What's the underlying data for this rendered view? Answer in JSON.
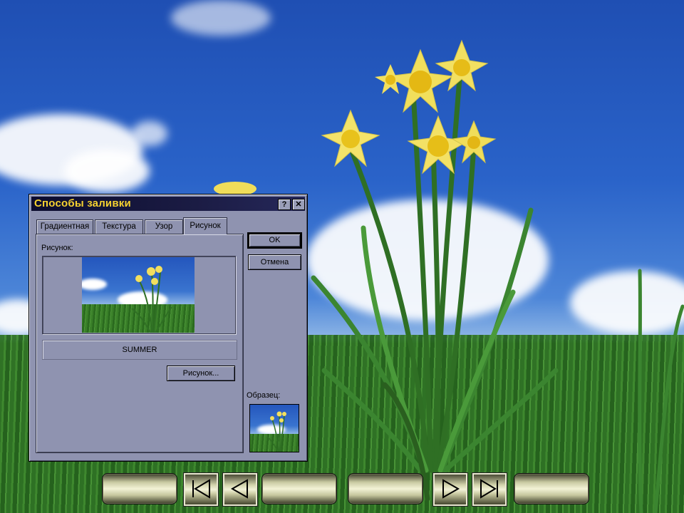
{
  "dialog": {
    "title": "Способы заливки",
    "help_button": "?",
    "close_button": "✕",
    "tabs": [
      {
        "label": "Градиентная",
        "active": false
      },
      {
        "label": "Текстура",
        "active": false
      },
      {
        "label": "Узор",
        "active": false
      },
      {
        "label": "Рисунок",
        "active": true
      }
    ],
    "picture_label": "Рисунок:",
    "picture_name": "SUMMER",
    "picture_button": "Рисунок...",
    "ok_button": "OK",
    "cancel_button": "Отмена",
    "sample_label": "Образец:"
  },
  "navigation": {
    "buttons": [
      {
        "name": "nav-blank-button-1",
        "icon": "none"
      },
      {
        "name": "nav-first-button",
        "icon": "first-slide-icon"
      },
      {
        "name": "nav-prev-button",
        "icon": "previous-slide-icon"
      },
      {
        "name": "nav-blank-button-2",
        "icon": "none"
      },
      {
        "name": "nav-blank-button-3",
        "icon": "none"
      },
      {
        "name": "nav-next-button",
        "icon": "next-slide-icon"
      },
      {
        "name": "nav-last-button",
        "icon": "last-slide-icon"
      },
      {
        "name": "nav-blank-button-4",
        "icon": "none"
      }
    ]
  },
  "colors": {
    "dialog_face": "#8f93b0",
    "title_text": "#f6d230",
    "title_bar": "#0c0c2e"
  }
}
